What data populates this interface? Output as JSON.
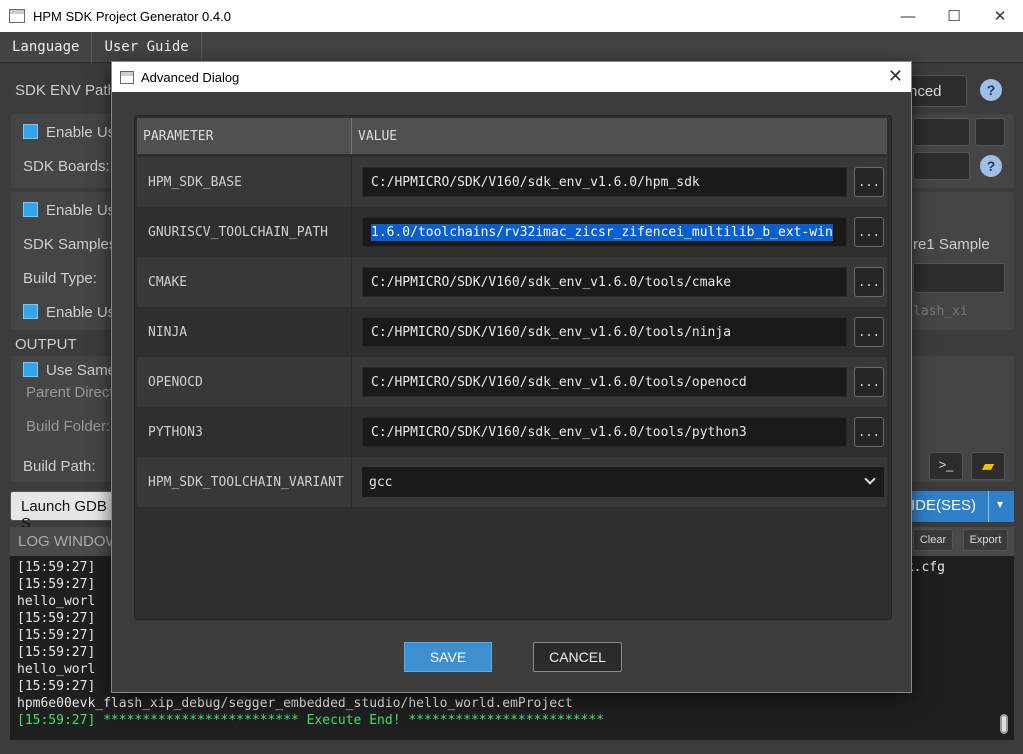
{
  "window": {
    "title": "HPM SDK Project Generator 0.4.0",
    "minimize": "—",
    "maximize": "☐",
    "close": "✕"
  },
  "menubar": {
    "items": [
      "Language",
      "User Guide"
    ]
  },
  "background": {
    "sdk_env_path_label": "SDK ENV Path",
    "advanced_button": "nced",
    "enable_use_1": "Enable Us",
    "sdk_boards_label": "SDK Boards:",
    "enable_use_2": "Enable Us",
    "sdk_samples_label": "SDK Samples",
    "build_type_label": "Build Type:",
    "enable_use_3": "Enable Us",
    "core_sample": "re1 Sample",
    "flash_xip_hint": "lash_xi",
    "output_label": "OUTPUT",
    "use_same": "Use Same",
    "parent_dir_label": "Parent Direct",
    "build_folder_label": "Build Folder:",
    "build_path_label": "Build Path:",
    "launch_gdb": "Launch GDB S",
    "ide_button": "IDE(SES)",
    "log_window_label": "LOG WINDOW",
    "clear_button": "Clear",
    "export_button": "Export",
    "log_cfg_tail": "vk.cfg",
    "log_lines": [
      "[15:59:27]",
      "[15:59:27]",
      "hello_worl",
      "[15:59:27]",
      "[15:59:27]",
      "[15:59:27]",
      "hello_worl",
      "[15:59:27]",
      "hpm6e00evk_flash_xip_debug/segger_embedded_studio/hello_world.emProject"
    ],
    "log_end_time": "[15:59:27]",
    "log_end_text": " ************************* Execute End! *************************"
  },
  "dialog": {
    "title": "Advanced Dialog",
    "close": "✕",
    "col_parameter": "PARAMETER",
    "col_value": "VALUE",
    "rows": [
      {
        "name": "HPM_SDK_BASE",
        "value": "C:/HPMICRO/SDK/V160/sdk_env_v1.6.0/hpm_sdk"
      },
      {
        "name": "GNURISCV_TOOLCHAIN_PATH",
        "value": "1.6.0/toolchains/rv32imac_zicsr_zifencei_multilib_b_ext-win"
      },
      {
        "name": "CMAKE",
        "value": "C:/HPMICRO/SDK/V160/sdk_env_v1.6.0/tools/cmake"
      },
      {
        "name": "NINJA",
        "value": "C:/HPMICRO/SDK/V160/sdk_env_v1.6.0/tools/ninja"
      },
      {
        "name": "OPENOCD",
        "value": "C:/HPMICRO/SDK/V160/sdk_env_v1.6.0/tools/openocd"
      },
      {
        "name": "PYTHON3",
        "value": "C:/HPMICRO/SDK/V160/sdk_env_v1.6.0/tools/python3"
      },
      {
        "name": "HPM_SDK_TOOLCHAIN_VARIANT",
        "value": "gcc"
      }
    ],
    "browse_label": "...",
    "save_label": "SAVE",
    "cancel_label": "CANCEL"
  }
}
